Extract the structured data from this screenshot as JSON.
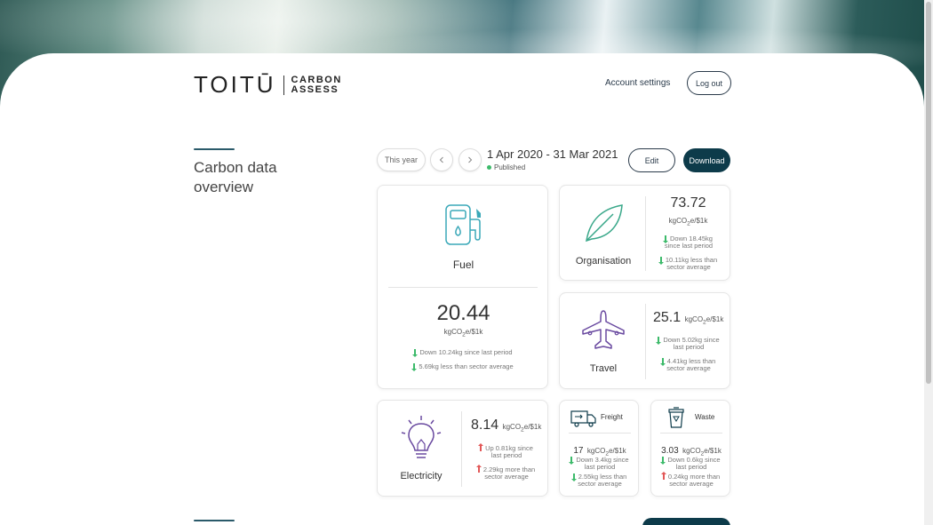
{
  "brand": {
    "name": "TOITŪ",
    "sub_line1": "CARBON",
    "sub_line2": "ASSESS"
  },
  "header": {
    "account_settings": "Account settings",
    "logout": "Log out"
  },
  "section": {
    "title_line1": "Carbon data",
    "title_line2": "overview"
  },
  "toolbar": {
    "period_button": "This year",
    "prev_icon": "chevron-left-icon",
    "next_icon": "chevron-right-icon",
    "date_range": "1 Apr 2020 - 31 Mar 2021",
    "status": "Published",
    "edit": "Edit",
    "download": "Download"
  },
  "colors": {
    "accent_dark": "#0d3b4a",
    "teal_icon": "#3aa8b8",
    "green_icon": "#3aa88a",
    "purple_icon": "#6a4aa0",
    "down": "#3cba6a",
    "up": "#e25757"
  },
  "unit_prefix": "kgCO",
  "unit_sub": "2",
  "unit_suffix": "e/$1k",
  "cards": {
    "fuel": {
      "label": "Fuel",
      "value": "20.44",
      "stat1": "Down 10.24kg since last period",
      "stat2": "5.69kg less than sector average",
      "icon": "fuel-pump-icon"
    },
    "organisation": {
      "label": "Organisation",
      "value": "73.72",
      "stat1a": "Down 18.45kg",
      "stat1b": "since last period",
      "stat2a": "10.11kg less than",
      "stat2b": "sector average",
      "icon": "leaf-icon"
    },
    "travel": {
      "label": "Travel",
      "value": "25.1",
      "stat1a": "Down 5.02kg since",
      "stat1b": "last period",
      "stat2a": "4.41kg less than",
      "stat2b": "sector average",
      "icon": "airplane-icon"
    },
    "electricity": {
      "label": "Electricity",
      "value": "8.14",
      "stat1a": "Up 0.81kg since",
      "stat1b": "last period",
      "stat2a": "2.29kg more than",
      "stat2b": "sector average",
      "icon": "lightbulb-icon"
    },
    "freight": {
      "label": "Freight",
      "value": "17",
      "stat1a": "Down 3.4kg since",
      "stat1b": "last period",
      "stat2a": "2.55kg less than",
      "stat2b": "sector average",
      "icon": "truck-icon"
    },
    "waste": {
      "label": "Waste",
      "value": "3.03",
      "stat1a": "Down 0.6kg since",
      "stat1b": "last period",
      "stat2a": "0.24kg more than",
      "stat2b": "sector average",
      "icon": "bin-icon"
    }
  }
}
